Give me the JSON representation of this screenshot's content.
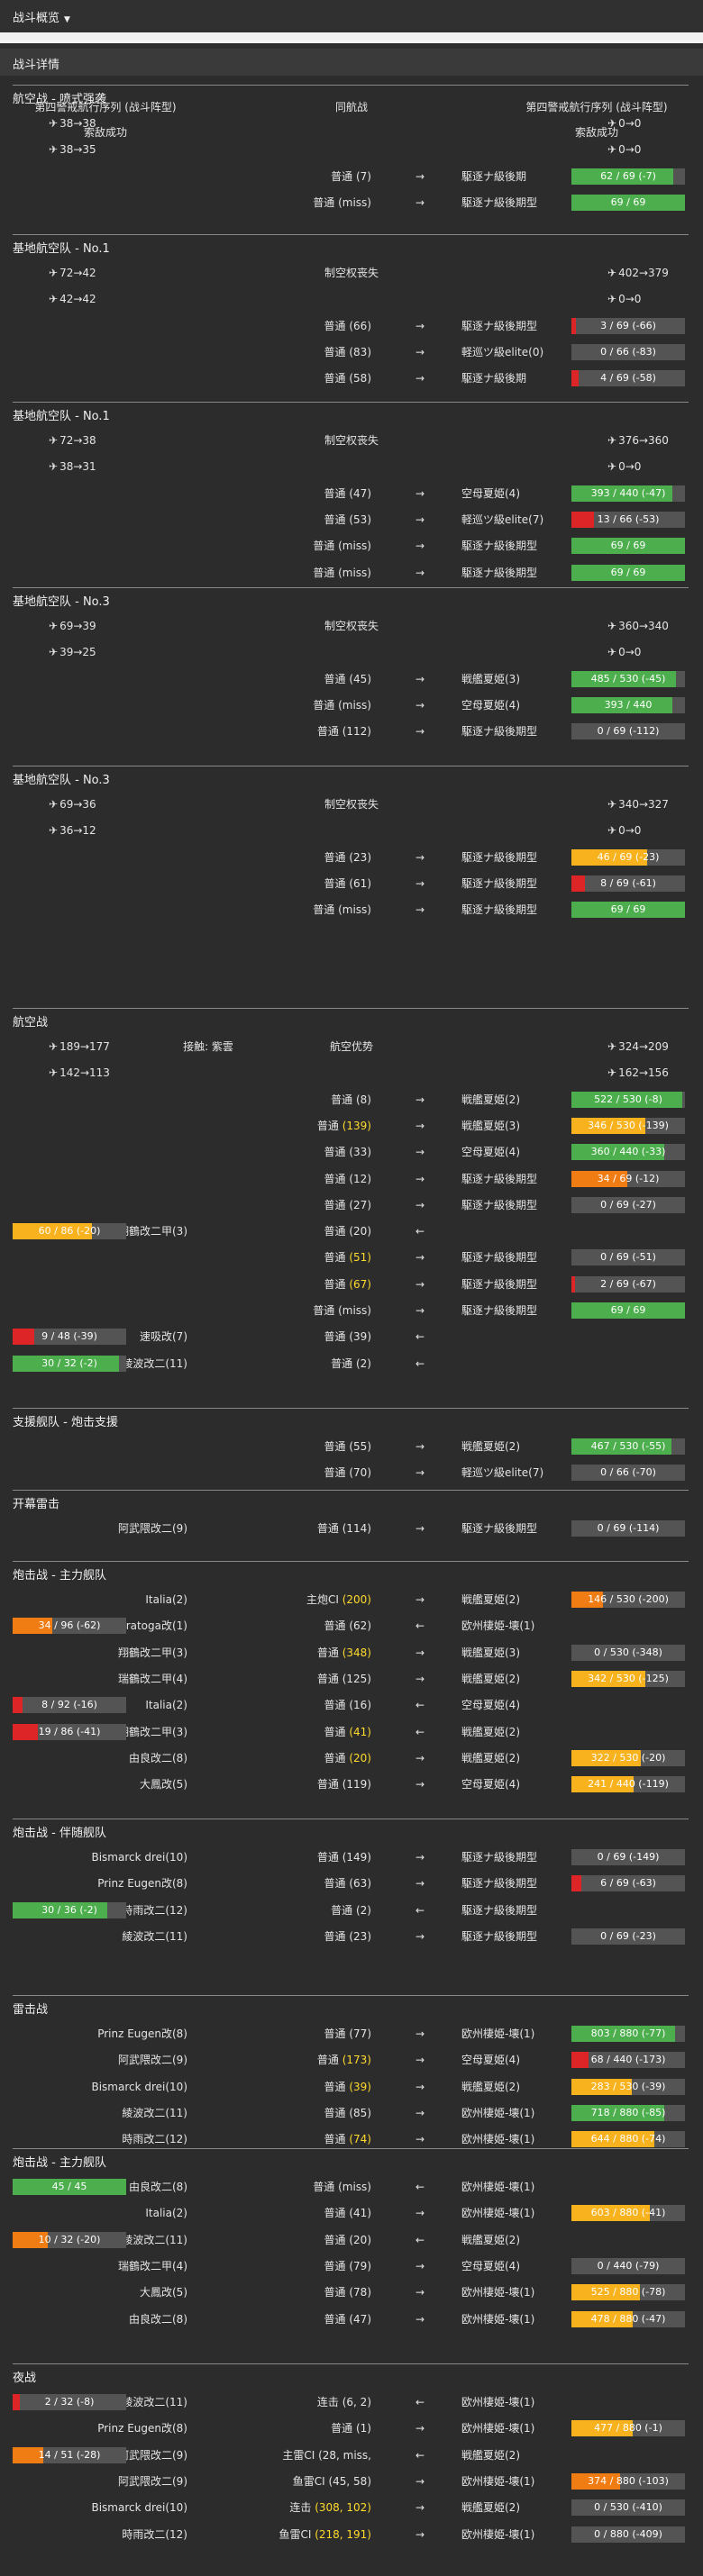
{
  "topbar": {
    "title": "战斗概览"
  },
  "section": {
    "title": "战斗详情"
  },
  "header": {
    "left_fleet": "第四警戒航行序列 (战斗阵型)",
    "middle": "同航战",
    "right_fleet": "第四警戒航行序列 (战斗阵型)",
    "left_result": "索敌成功",
    "right_result": "索敌成功"
  },
  "icons": {
    "plane": "plane-icon",
    "arrow_right": "→",
    "arrow_left": "←"
  },
  "colors": {
    "green": "#4cae4c",
    "yellow": "#f7b21e",
    "orange": "#f07c14",
    "red": "#dd2528",
    "empty": "#545454"
  },
  "stages": [
    {
      "title": "航空战 - 喷式强袭",
      "air": [
        {
          "l": "38→38",
          "r": "0→0"
        },
        {
          "l": "38→35",
          "r": "0→0"
        }
      ],
      "rows": [
        {
          "attack": "普通 (7)",
          "dir": "→",
          "target": "駆逐ナ級後期",
          "hp": "62 / 69 (-7)",
          "frac": 0.9,
          "color": "green"
        },
        {
          "attack": "普通 (miss)",
          "dir": "→",
          "target": "駆逐ナ級後期型",
          "hp": "69 / 69",
          "frac": 1,
          "color": "green"
        }
      ]
    },
    {
      "title": "基地航空队 - No.1",
      "air": [
        {
          "l": "72→42",
          "mid": "制空权丧失",
          "r": "402→379"
        },
        {
          "l": "42→42",
          "r": "0→0"
        }
      ],
      "rows": [
        {
          "attack": "普通 (66)",
          "dir": "→",
          "target": "駆逐ナ級後期型",
          "hp": "3 / 69 (-66)",
          "frac": 0.04,
          "color": "red"
        },
        {
          "attack": "普通 (83)",
          "dir": "→",
          "target": "軽巡ツ級elite(0)",
          "hp": "0 / 66 (-83)",
          "frac": 0,
          "color": "red"
        },
        {
          "attack": "普通 (58)",
          "dir": "→",
          "target": "駆逐ナ級後期",
          "hp": "4 / 69 (-58)",
          "frac": 0.06,
          "color": "red"
        }
      ]
    },
    {
      "title": "基地航空队 - No.1",
      "air": [
        {
          "l": "72→38",
          "mid": "制空权丧失",
          "r": "376→360"
        },
        {
          "l": "38→31",
          "r": "0→0"
        }
      ],
      "rows": [
        {
          "attack": "普通 (47)",
          "dir": "→",
          "target": "空母夏姫(4)",
          "hp": "393 / 440 (-47)",
          "frac": 0.89,
          "color": "green"
        },
        {
          "attack": "普通 (53)",
          "dir": "→",
          "target": "軽巡ツ級elite(7)",
          "hp": "13 / 66 (-53)",
          "frac": 0.2,
          "color": "red"
        },
        {
          "attack": "普通 (miss)",
          "dir": "→",
          "target": "駆逐ナ級後期型",
          "hp": "69 / 69",
          "frac": 1,
          "color": "green"
        },
        {
          "attack": "普通 (miss)",
          "dir": "→",
          "target": "駆逐ナ級後期型",
          "hp": "69 / 69",
          "frac": 1,
          "color": "green"
        }
      ]
    },
    {
      "title": "基地航空队 - No.3",
      "air": [
        {
          "l": "69→39",
          "mid": "制空权丧失",
          "r": "360→340"
        },
        {
          "l": "39→25",
          "r": "0→0"
        }
      ],
      "rows": [
        {
          "attack": "普通 (45)",
          "dir": "→",
          "target": "戦艦夏姫(3)",
          "hp": "485 / 530 (-45)",
          "frac": 0.92,
          "color": "green"
        },
        {
          "attack": "普通 (miss)",
          "dir": "→",
          "target": "空母夏姫(4)",
          "hp": "393 / 440",
          "frac": 0.89,
          "color": "green"
        },
        {
          "attack": "普通 (112)",
          "dir": "→",
          "target": "駆逐ナ級後期型",
          "hp": "0 / 69 (-112)",
          "frac": 0,
          "color": "red"
        }
      ]
    },
    {
      "title": "基地航空队 - No.3",
      "air": [
        {
          "l": "69→36",
          "mid": "制空权丧失",
          "r": "340→327"
        },
        {
          "l": "36→12",
          "r": "0→0"
        }
      ],
      "rows": [
        {
          "attack": "普通 (23)",
          "dir": "→",
          "target": "駆逐ナ級後期型",
          "hp": "46 / 69 (-23)",
          "frac": 0.67,
          "color": "yellow"
        },
        {
          "attack": "普通 (61)",
          "dir": "→",
          "target": "駆逐ナ級後期型",
          "hp": "8 / 69 (-61)",
          "frac": 0.12,
          "color": "red"
        },
        {
          "attack": "普通 (miss)",
          "dir": "→",
          "target": "駆逐ナ級後期型",
          "hp": "69 / 69",
          "frac": 1,
          "color": "green"
        }
      ]
    },
    {
      "title": "航空战",
      "air": [
        {
          "l": "189→177",
          "touch": "接触: 紫雲",
          "mid": "航空优势",
          "r": "324→209"
        },
        {
          "l": "142→113",
          "r": "162→156"
        }
      ],
      "rows": [
        {
          "attack": "普通 (8)",
          "dir": "→",
          "target": "戦艦夏姫(2)",
          "hp": "522 / 530 (-8)",
          "frac": 0.98,
          "color": "green"
        },
        {
          "attack": "普通 ",
          "hl": "(139)",
          "dir": "→",
          "target": "戦艦夏姫(3)",
          "hp": "346 / 530 (-139)",
          "frac": 0.65,
          "color": "yellow"
        },
        {
          "attack": "普通 (33)",
          "dir": "→",
          "target": "空母夏姫(4)",
          "hp": "360 / 440 (-33)",
          "frac": 0.82,
          "color": "green"
        },
        {
          "attack": "普通 (12)",
          "dir": "→",
          "target": "駆逐ナ級後期型",
          "hp": "34 / 69 (-12)",
          "frac": 0.49,
          "color": "orange"
        },
        {
          "attack": "普通 (27)",
          "dir": "→",
          "target": "駆逐ナ級後期型",
          "hp": "0 / 69 (-27)",
          "frac": 0,
          "color": "red"
        },
        {
          "attack": "普通 (20)",
          "dir": "←",
          "ship": "翔鶴改二甲(3)",
          "lhp": "60 / 86 (-20)",
          "lfrac": 0.7,
          "lcolor": "yellow"
        },
        {
          "attack": "普通 ",
          "hl": "(51)",
          "dir": "→",
          "target": "駆逐ナ級後期型",
          "hp": "0 / 69 (-51)",
          "frac": 0,
          "color": "red"
        },
        {
          "attack": "普通 ",
          "hl": "(67)",
          "dir": "→",
          "target": "駆逐ナ級後期型",
          "hp": "2 / 69 (-67)",
          "frac": 0.03,
          "color": "red"
        },
        {
          "attack": "普通 (miss)",
          "dir": "→",
          "target": "駆逐ナ級後期型",
          "hp": "69 / 69",
          "frac": 1,
          "color": "green"
        },
        {
          "attack": "普通 (39)",
          "dir": "←",
          "ship": "速吸改(7)",
          "lhp": "9 / 48 (-39)",
          "lfrac": 0.19,
          "lcolor": "red"
        },
        {
          "attack": "普通 (2)",
          "dir": "←",
          "ship": "綾波改二(11)",
          "lhp": "30 / 32 (-2)",
          "lfrac": 0.94,
          "lcolor": "green"
        }
      ]
    },
    {
      "title": "支援舰队 - 炮击支援",
      "rows": [
        {
          "attack": "普通 (55)",
          "dir": "→",
          "target": "戦艦夏姫(2)",
          "hp": "467 / 530 (-55)",
          "frac": 0.88,
          "color": "green"
        },
        {
          "attack": "普通 (70)",
          "dir": "→",
          "target": "軽巡ツ級elite(7)",
          "hp": "0 / 66 (-70)",
          "frac": 0,
          "color": "red"
        }
      ]
    },
    {
      "title": "开幕雷击",
      "rows": [
        {
          "ship": "阿武隈改二(9)",
          "attack": "普通 (114)",
          "dir": "→",
          "target": "駆逐ナ級後期型",
          "hp": "0 / 69 (-114)",
          "frac": 0,
          "color": "red"
        }
      ]
    },
    {
      "title": "炮击战 - 主力舰队",
      "rows": [
        {
          "ship": "Italia(2)",
          "attack": "主炮CI ",
          "hl": "(200)",
          "dir": "→",
          "target": "戦艦夏姫(2)",
          "hp": "146 / 530 (-200)",
          "frac": 0.28,
          "color": "orange"
        },
        {
          "ship": "Saratoga改(1)",
          "attack": "普通 (62)",
          "dir": "←",
          "target": "欧州棲姫-壊(1)",
          "lhp": "34 / 96 (-62)",
          "lfrac": 0.35,
          "lcolor": "orange"
        },
        {
          "ship": "翔鶴改二甲(3)",
          "attack": "普通 ",
          "hl": "(348)",
          "dir": "→",
          "target": "戦艦夏姫(3)",
          "hp": "0 / 530 (-348)",
          "frac": 0,
          "color": "red"
        },
        {
          "ship": "瑞鶴改二甲(4)",
          "attack": "普通 (125)",
          "dir": "→",
          "target": "戦艦夏姫(2)",
          "hp": "342 / 530 (-125)",
          "frac": 0.65,
          "color": "yellow"
        },
        {
          "ship": "Italia(2)",
          "attack": "普通 (16)",
          "dir": "←",
          "target": "空母夏姫(4)",
          "lhp": "8 / 92 (-16)",
          "lfrac": 0.09,
          "lcolor": "red"
        },
        {
          "ship": "翔鶴改二甲(3)",
          "attack": "普通 ",
          "hl": "(41)",
          "dir": "←",
          "target": "戦艦夏姫(2)",
          "lhp": "19 / 86 (-41)",
          "lfrac": 0.22,
          "lcolor": "red"
        },
        {
          "ship": "由良改二(8)",
          "attack": "普通 ",
          "hl": "(20)",
          "dir": "→",
          "target": "戦艦夏姫(2)",
          "hp": "322 / 530 (-20)",
          "frac": 0.61,
          "color": "yellow"
        },
        {
          "ship": "大鳳改(5)",
          "attack": "普通 (119)",
          "dir": "→",
          "target": "空母夏姫(4)",
          "hp": "241 / 440 (-119)",
          "frac": 0.55,
          "color": "yellow"
        }
      ]
    },
    {
      "title": "炮击战 - 伴随舰队",
      "rows": [
        {
          "ship": "Bismarck drei(10)",
          "attack": "普通 (149)",
          "dir": "→",
          "target": "駆逐ナ級後期型",
          "hp": "0 / 69 (-149)",
          "frac": 0,
          "color": "red"
        },
        {
          "ship": "Prinz Eugen改(8)",
          "attack": "普通 (63)",
          "dir": "→",
          "target": "駆逐ナ級後期型",
          "hp": "6 / 69 (-63)",
          "frac": 0.09,
          "color": "red"
        },
        {
          "ship": "時雨改二(12)",
          "attack": "普通 (2)",
          "dir": "←",
          "target": "駆逐ナ級後期型",
          "lhp": "30 / 36 (-2)",
          "lfrac": 0.83,
          "lcolor": "green"
        },
        {
          "ship": "綾波改二(11)",
          "attack": "普通 (23)",
          "dir": "→",
          "target": "駆逐ナ級後期型",
          "hp": "0 / 69 (-23)",
          "frac": 0,
          "color": "red"
        }
      ]
    },
    {
      "title": "雷击战",
      "rows": [
        {
          "ship": "Prinz Eugen改(8)",
          "attack": "普通 (77)",
          "dir": "→",
          "target": "欧州棲姫-壊(1)",
          "hp": "803 / 880 (-77)",
          "frac": 0.91,
          "color": "green"
        },
        {
          "ship": "阿武隈改二(9)",
          "attack": "普通 ",
          "hl": "(173)",
          "dir": "→",
          "target": "空母夏姫(4)",
          "hp": "68 / 440 (-173)",
          "frac": 0.15,
          "color": "red"
        },
        {
          "ship": "Bismarck drei(10)",
          "attack": "普通 ",
          "hl": "(39)",
          "dir": "→",
          "target": "戦艦夏姫(2)",
          "hp": "283 / 530 (-39)",
          "frac": 0.53,
          "color": "yellow"
        },
        {
          "ship": "綾波改二(11)",
          "attack": "普通 (85)",
          "dir": "→",
          "target": "欧州棲姫-壊(1)",
          "hp": "718 / 880 (-85)",
          "frac": 0.82,
          "color": "green"
        },
        {
          "ship": "時雨改二(12)",
          "attack": "普通 ",
          "hl": "(74)",
          "dir": "→",
          "target": "欧州棲姫-壊(1)",
          "hp": "644 / 880 (-74)",
          "frac": 0.73,
          "color": "yellow"
        }
      ]
    },
    {
      "title": "炮击战 - 主力舰队",
      "rows": [
        {
          "ship": "由良改二(8)",
          "attack": "普通 (miss)",
          "dir": "←",
          "target": "欧州棲姫-壊(1)",
          "lhp": "45 / 45",
          "lfrac": 1,
          "lcolor": "green"
        },
        {
          "ship": "Italia(2)",
          "attack": "普通 (41)",
          "dir": "→",
          "target": "欧州棲姫-壊(1)",
          "hp": "603 / 880 (-41)",
          "frac": 0.69,
          "color": "yellow"
        },
        {
          "ship": "綾波改二(11)",
          "attack": "普通 (20)",
          "dir": "←",
          "target": "戦艦夏姫(2)",
          "lhp": "10 / 32 (-20)",
          "lfrac": 0.31,
          "lcolor": "orange"
        },
        {
          "ship": "瑞鶴改二甲(4)",
          "attack": "普通 (79)",
          "dir": "→",
          "target": "空母夏姫(4)",
          "hp": "0 / 440 (-79)",
          "frac": 0,
          "color": "red"
        },
        {
          "ship": "大鳳改(5)",
          "attack": "普通 (78)",
          "dir": "→",
          "target": "欧州棲姫-壊(1)",
          "hp": "525 / 880 (-78)",
          "frac": 0.6,
          "color": "yellow"
        },
        {
          "ship": "由良改二(8)",
          "attack": "普通 (47)",
          "dir": "→",
          "target": "欧州棲姫-壊(1)",
          "hp": "478 / 880 (-47)",
          "frac": 0.54,
          "color": "yellow"
        }
      ]
    },
    {
      "title": "夜战",
      "rows": [
        {
          "ship": "綾波改二(11)",
          "attack": "连击 (6, 2)",
          "dir": "←",
          "target": "欧州棲姫-壊(1)",
          "lhp": "2 / 32 (-8)",
          "lfrac": 0.06,
          "lcolor": "red"
        },
        {
          "ship": "Prinz Eugen改(8)",
          "attack": "普通 (1)",
          "dir": "→",
          "target": "欧州棲姫-壊(1)",
          "hp": "477 / 880 (-1)",
          "frac": 0.54,
          "color": "yellow"
        },
        {
          "ship": "阿武隈改二(9)",
          "attack": "主雷CI (28, miss,",
          "dir": "←",
          "target": "戦艦夏姫(2)",
          "lhp": "14 / 51 (-28)",
          "lfrac": 0.27,
          "lcolor": "orange"
        },
        {
          "ship": "阿武隈改二(9)",
          "attack": "鱼雷CI (45, 58)",
          "dir": "→",
          "target": "欧州棲姫-壊(1)",
          "hp": "374 / 880 (-103)",
          "frac": 0.43,
          "color": "orange"
        },
        {
          "ship": "Bismarck drei(10)",
          "attack": "连击 ",
          "hl": "(308, 102)",
          "dir": "→",
          "target": "戦艦夏姫(2)",
          "hp": "0 / 530 (-410)",
          "frac": 0,
          "color": "red"
        },
        {
          "ship": "時雨改二(12)",
          "attack": "鱼雷CI ",
          "hl": "(218, 191)",
          "dir": "→",
          "target": "欧州棲姫-壊(1)",
          "hp": "0 / 880 (-409)",
          "frac": 0,
          "color": "red"
        }
      ]
    }
  ]
}
